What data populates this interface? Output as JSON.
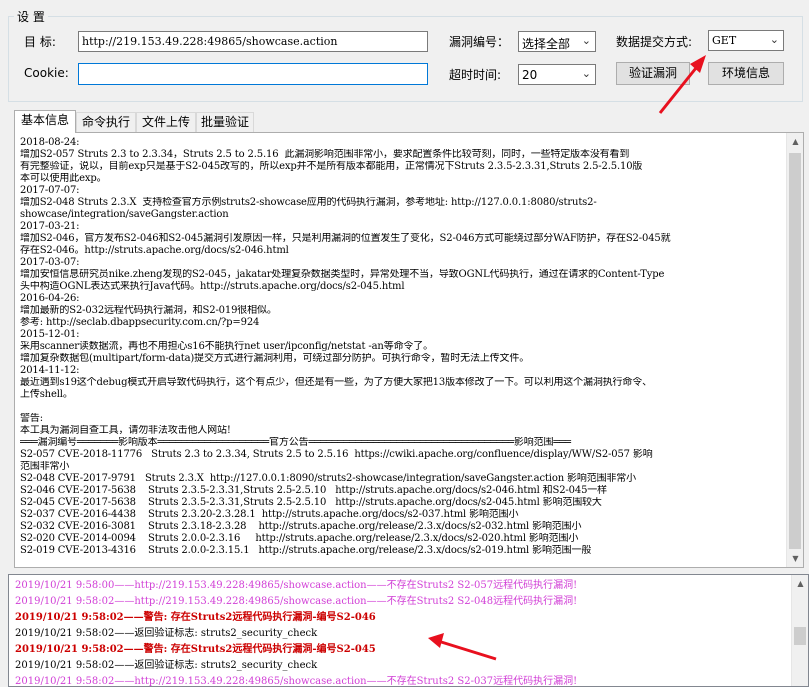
{
  "settings": {
    "title": "设 置",
    "target_label": "目  标:",
    "target_value": "http://219.153.49.228:49865/showcase.action",
    "cookie_label": "Cookie:",
    "cookie_value": "",
    "vuln_id_label": "漏洞编号：",
    "vuln_id_value": "选择全部",
    "timeout_label": "超时时间:",
    "timeout_value": "20",
    "submit_method_label": "数据提交方式:",
    "submit_method_value": "GET",
    "verify_button": "验证漏洞",
    "env_button": "环境信息"
  },
  "tabs": [
    {
      "label": "基本信息",
      "active": true
    },
    {
      "label": "命令执行",
      "active": false
    },
    {
      "label": "文件上传",
      "active": false
    },
    {
      "label": "批量验证",
      "active": false
    }
  ],
  "info_lines": [
    "2018-08-24:",
    "增加S2-057 Struts 2.3 to 2.3.34，Struts 2.5 to 2.5.16  此漏洞影响范围非常小，要求配置条件比较苛刻，同时，一些特定版本没有看到",
    "有完整验证，说以，目前exp只是基于S2-045改写的，所以exp并不是所有版本都能用，正常情况下Struts 2.3.5-2.3.31,Struts 2.5-2.5.10版",
    "本可以使用此exp。",
    "2017-07-07:",
    "增加S2-048 Struts 2.3.X  支持检查官方示例struts2-showcase应用的代码执行漏洞，参考地址: http://127.0.0.1:8080/struts2-",
    "showcase/integration/saveGangster.action",
    "2017-03-21:",
    "增加S2-046，官方发布S2-046和S2-045漏洞引发原因一样，只是利用漏洞的位置发生了变化，S2-046方式可能绕过部分WAF防护，存在S2-045就",
    "存在S2-046。http://struts.apache.org/docs/s2-046.html",
    "2017-03-07:",
    "增加安恒信息研究员nike.zheng发现的S2-045，jakatar处理复杂数据类型时，异常处理不当，导致OGNL代码执行，通过在请求的Content-Type",
    "头中构造OGNL表达式来执行Java代码。http://struts.apache.org/docs/s2-045.html",
    "2016-04-26:",
    "增加最新的S2-032远程代码执行漏洞，和S2-019很相似。",
    "参考: http://seclab.dbappsecurity.com.cn/?p=924",
    "2015-12-01:",
    "采用scanner读数据流，再也不用担心s16不能执行net user/ipconfig/netstat -an等命令了。",
    "增加复杂数据包(multipart/form-data)提交方式进行漏洞利用，可绕过部分防护。可执行命令，暂时无法上传文件。",
    "2014-11-12:",
    "最近遇到s19这个debug模式开启导致代码执行，这个有点少，但还是有一些，为了方便大家把13版本修改了一下。可以利用这个漏洞执行命令、",
    "上传shell。",
    "",
    "警告:",
    "本工具为漏洞自查工具，请勿非法攻击他人网站!",
    "═══漏洞编号═══════影响版本═══════════════════官方公告═══════════════════════════════════影响范围═══",
    "S2-057 CVE-2018-11776   Struts 2.3 to 2.3.34, Struts 2.5 to 2.5.16  https://cwiki.apache.org/confluence/display/WW/S2-057 影响",
    "范围非常小",
    "S2-048 CVE-2017-9791   Struts 2.3.X  http://127.0.0.1:8090/struts2-showcase/integration/saveGangster.action 影响范围非常小",
    "S2-046 CVE-2017-5638    Struts 2.3.5-2.3.31,Struts 2.5-2.5.10   http://struts.apache.org/docs/s2-046.html 和S2-045一样",
    "S2-045 CVE-2017-5638    Struts 2.3.5-2.3.31,Struts 2.5-2.5.10   http://struts.apache.org/docs/s2-045.html 影响范围较大",
    "S2-037 CVE-2016-4438    Struts 2.3.20-2.3.28.1  http://struts.apache.org/docs/s2-037.html 影响范围小",
    "S2-032 CVE-2016-3081    Struts 2.3.18-2.3.28    http://struts.apache.org/release/2.3.x/docs/s2-032.html 影响范围小",
    "S2-020 CVE-2014-0094    Struts 2.0.0-2.3.16     http://struts.apache.org/release/2.3.x/docs/s2-020.html 影响范围小",
    "S2-019 CVE-2013-4316    Struts 2.0.0-2.3.15.1   http://struts.apache.org/release/2.3.x/docs/s2-019.html 影响范围一般"
  ],
  "log_lines": [
    {
      "text": "2019/10/21 9:58:00——http://219.153.49.228:49865/showcase.action——不存在Struts2 S2-057远程代码执行漏洞!",
      "color": "pink"
    },
    {
      "text": "2019/10/21 9:58:02——http://219.153.49.228:49865/showcase.action——不存在Struts2 S2-048远程代码执行漏洞!",
      "color": "pink"
    },
    {
      "text": "2019/10/21 9:58:02——警告: 存在Struts2远程代码执行漏洞-编号S2-046",
      "color": "red"
    },
    {
      "text": "2019/10/21 9:58:02——返回验证标志: struts2_security_check",
      "color": "black"
    },
    {
      "text": "2019/10/21 9:58:02——警告: 存在Struts2远程代码执行漏洞-编号S2-045",
      "color": "red"
    },
    {
      "text": "2019/10/21 9:58:02——返回验证标志: struts2_security_check",
      "color": "black"
    },
    {
      "text": "2019/10/21 9:58:02——http://219.153.49.228:49865/showcase.action——不存在Struts2 S2-037远程代码执行漏洞!",
      "color": "pink"
    }
  ],
  "icons": {
    "combo_chevron": "chevron-down-icon",
    "scroll_up": "arrow-up-icon",
    "scroll_down": "arrow-down-icon",
    "annotation": "red-arrow-annotation"
  },
  "colors": {
    "log_pink": "#d13fd6",
    "log_red": "#cc0000",
    "annotation_red": "#e8101e",
    "focus_blue": "#0078d7"
  }
}
